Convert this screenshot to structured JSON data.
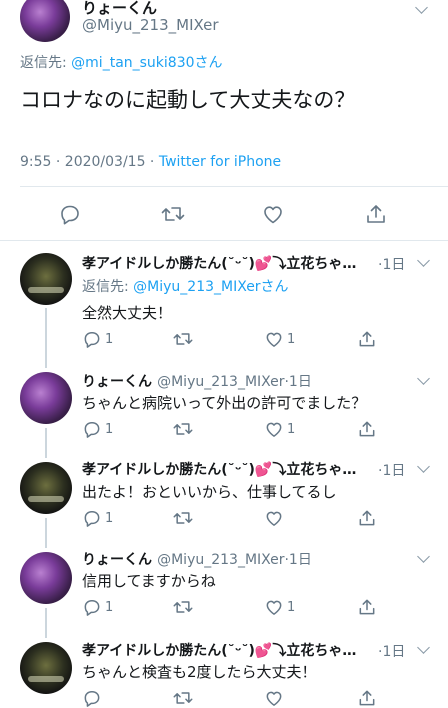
{
  "main_tweet": {
    "name": "りょーくん",
    "handle": "@Miyu_213_MIXer",
    "reply_prefix": "返信先: ",
    "reply_target": "@mi_tan_suki830さん",
    "text": "コロナなのに起動して大丈夫なの？",
    "timestamp": "9:55 · 2020/03/15 · ",
    "source": "Twitter for iPhone"
  },
  "replies": [
    {
      "name": "孝アイドルしか勝たん(˘ᵕ˘)💕⤵︎立花ちゃ…",
      "age": "·1日",
      "reply_prefix": "返信先: ",
      "reply_target": "@Miyu_213_MIXerさん",
      "text": "全然大丈夫！",
      "reply_count": "1",
      "like_count": "1"
    },
    {
      "name": "りょーくん",
      "handle": "@Miyu_213_MIXer",
      "age": "·1日",
      "text": "ちゃんと病院いって外出の許可でました？",
      "reply_count": "1",
      "like_count": "1"
    },
    {
      "name": "孝アイドルしか勝たん(˘ᵕ˘)💕⤵︎立花ちゃ…",
      "age": "·1日",
      "text": "出たよ！おといいから、仕事してるし",
      "reply_count": "1",
      "like_count": ""
    },
    {
      "name": "りょーくん",
      "handle": "@Miyu_213_MIXer",
      "age": "·1日",
      "text": "信用してますからね",
      "reply_count": "1",
      "like_count": "1"
    },
    {
      "name": "孝アイドルしか勝たん(˘ᵕ˘)💕⤵︎立花ちゃ…",
      "age": "·1日",
      "text": "ちゃんと検査も2度したら大丈夫！",
      "reply_count": "",
      "like_count": ""
    }
  ],
  "icons": [
    "reply-icon",
    "retweet-icon",
    "like-icon",
    "share-icon",
    "chevron-down-icon"
  ]
}
